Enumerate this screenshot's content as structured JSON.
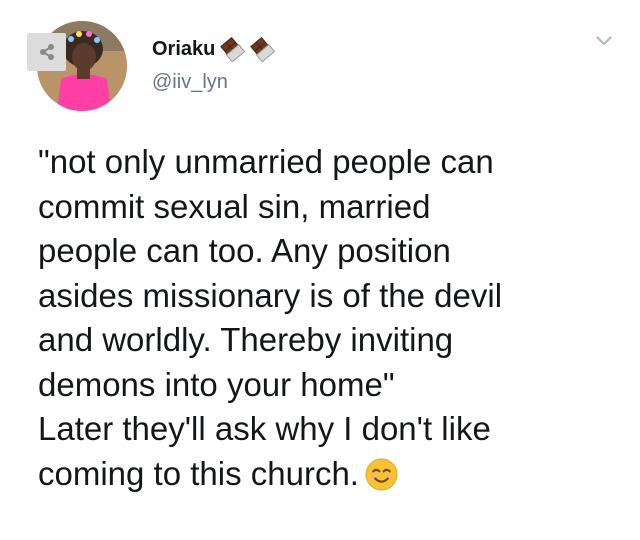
{
  "user": {
    "display_name": "Oriaku",
    "handle": "@iiv_lyn",
    "badges": [
      "chocolate-bar-icon",
      "chocolate-bar-icon"
    ]
  },
  "controls": {
    "share_icon": "share-icon",
    "menu_icon": "chevron-down-icon"
  },
  "tweet": {
    "lines": [
      "\"not only unmarried people can",
      "commit sexual sin, married",
      "people can too. Any position",
      "asides missionary is of the devil",
      "and worldly. Thereby inviting",
      "demons into your home\"",
      "Later they'll ask why I don't like",
      "coming to this church."
    ],
    "trailing_emoji": "smiling-face-icon"
  },
  "colors": {
    "text": "#14171a",
    "handle": "#657786",
    "share_bg": "#dcdcdc",
    "avatar_top": "#ff3fa6",
    "emoji_face": "#f7c334"
  }
}
